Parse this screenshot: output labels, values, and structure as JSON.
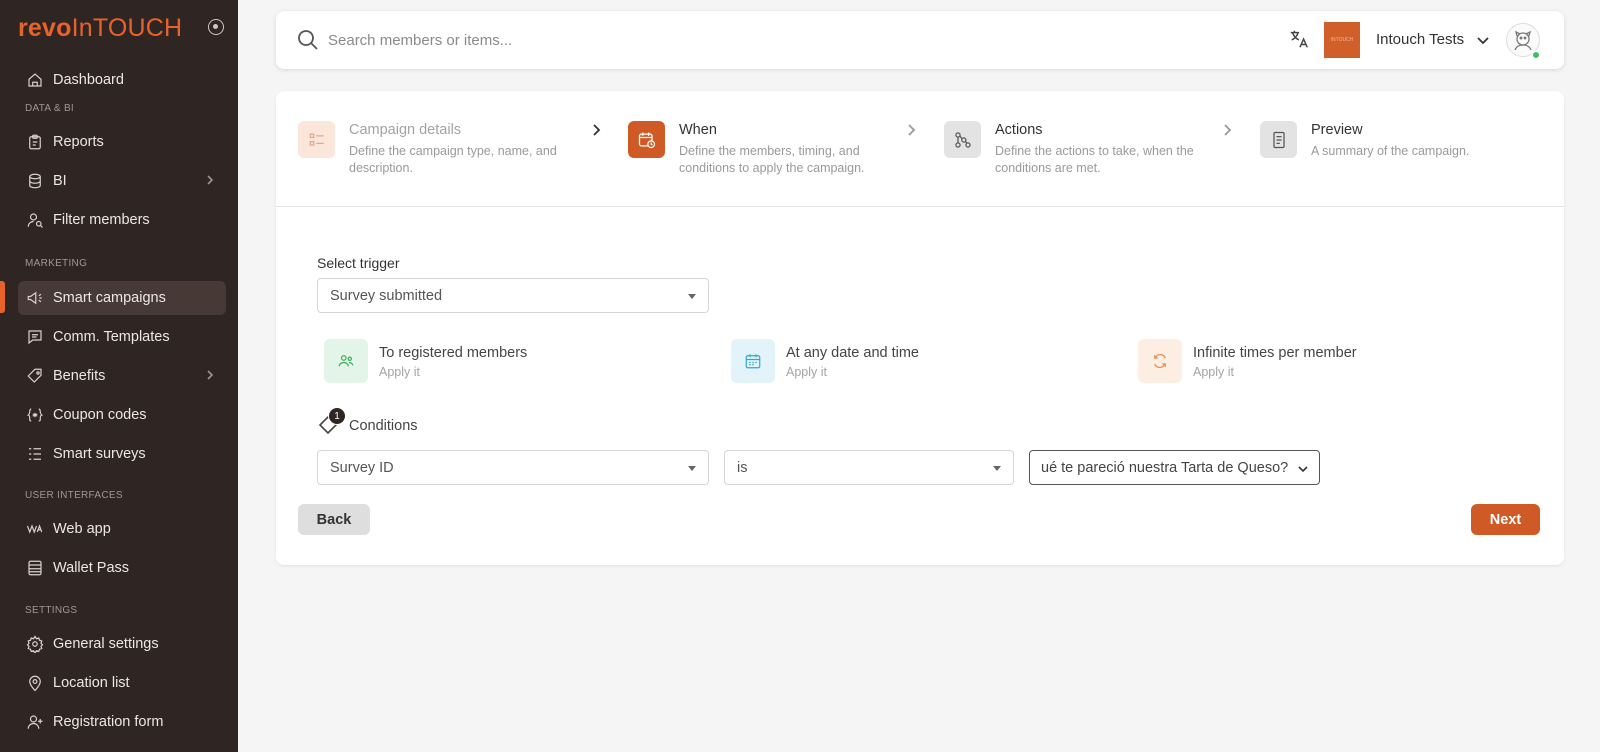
{
  "brand": {
    "logo_part1": "revo",
    "logo_part2": "InTOUCH"
  },
  "sidebar": {
    "sections": {
      "data_bi": "DATA & BI",
      "marketing": "MARKETING",
      "user_interfaces": "USER INTERFACES",
      "settings": "SETTINGS"
    },
    "items": [
      {
        "label": "Dashboard",
        "icon": "home-icon"
      },
      {
        "label": "Reports",
        "icon": "clipboard-icon"
      },
      {
        "label": "BI",
        "icon": "database-icon",
        "has_submenu": true
      },
      {
        "label": "Filter members",
        "icon": "user-search-icon"
      },
      {
        "label": "Smart campaigns",
        "icon": "megaphone-icon",
        "active": true
      },
      {
        "label": "Comm. Templates",
        "icon": "chat-icon"
      },
      {
        "label": "Benefits",
        "icon": "badge-icon",
        "has_submenu": true
      },
      {
        "label": "Coupon codes",
        "icon": "coupon-icon"
      },
      {
        "label": "Smart surveys",
        "icon": "list-icon"
      },
      {
        "label": "Web app",
        "icon": "pwa-icon"
      },
      {
        "label": "Wallet Pass",
        "icon": "wallet-icon"
      },
      {
        "label": "General settings",
        "icon": "gear-icon"
      },
      {
        "label": "Location list",
        "icon": "map-pin-icon"
      },
      {
        "label": "Registration form",
        "icon": "user-plus-icon"
      }
    ]
  },
  "header": {
    "search_placeholder": "Search members or items...",
    "org_logo_text": "INTOUCH",
    "org_name": "Intouch Tests"
  },
  "wizard": {
    "steps": [
      {
        "title": "Campaign details",
        "desc": "Define the campaign type, name, and description.",
        "state": "done"
      },
      {
        "title": "When",
        "desc": "Define the members, timing, and conditions to apply the campaign.",
        "state": "active"
      },
      {
        "title": "Actions",
        "desc": "Define the actions to take, when the conditions are met.",
        "state": "pending"
      },
      {
        "title": "Preview",
        "desc": "A summary of the campaign.",
        "state": "pending"
      }
    ]
  },
  "form": {
    "trigger_label": "Select trigger",
    "trigger_value": "Survey submitted",
    "rules": [
      {
        "title": "To registered members",
        "sub": "Apply it",
        "icon": "users-icon",
        "color": "#3fae5a",
        "bg": "#e3f5e8"
      },
      {
        "title": "At any date and time",
        "sub": "Apply it",
        "icon": "calendar-icon",
        "color": "#35a9c9",
        "bg": "#e2f4f9"
      },
      {
        "title": "Infinite times per member",
        "sub": "Apply it",
        "icon": "repeat-icon",
        "color": "#e88a4a",
        "bg": "#fdeee3"
      }
    ],
    "conditions_label": "Conditions",
    "conditions_count": "1",
    "condition": {
      "field": "Survey ID",
      "operator": "is",
      "value": "ué te pareció nuestra Tarta de Queso?"
    }
  },
  "buttons": {
    "back": "Back",
    "next": "Next"
  },
  "colors": {
    "accent": "#cf5a25",
    "sidebar_bg": "#2f2523"
  }
}
